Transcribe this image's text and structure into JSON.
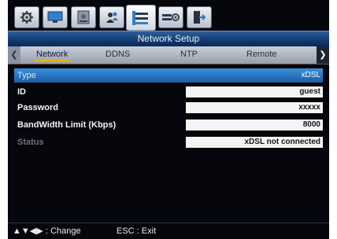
{
  "top_tabs": [
    {
      "icon": "gear-icon"
    },
    {
      "icon": "monitor-icon"
    },
    {
      "icon": "hdd-icon"
    },
    {
      "icon": "users-icon"
    },
    {
      "icon": "network-icon",
      "active": true
    },
    {
      "icon": "event-icon"
    },
    {
      "icon": "exit-icon"
    }
  ],
  "header": {
    "title": "Network Setup"
  },
  "subtabs": {
    "items": [
      "Network",
      "DDNS",
      "NTP",
      "Remote"
    ],
    "active": "Network"
  },
  "settings": [
    {
      "label": "Type",
      "value": "xDSL"
    },
    {
      "label": "ID",
      "value": "guest"
    },
    {
      "label": "Password",
      "value": "xxxxx"
    },
    {
      "label": "BandWidth Limit (Kbps)",
      "value": "8000"
    },
    {
      "label": "Status",
      "value": "xDSL not connected"
    }
  ],
  "footer": {
    "change_keys": "▲▼◀▶",
    "change_label": ": Change",
    "esc_label": "ESC : Exit"
  },
  "colors": {
    "accent_underline": "#e5b400",
    "selected_row": "#2a77c4",
    "header": "#123a70"
  }
}
